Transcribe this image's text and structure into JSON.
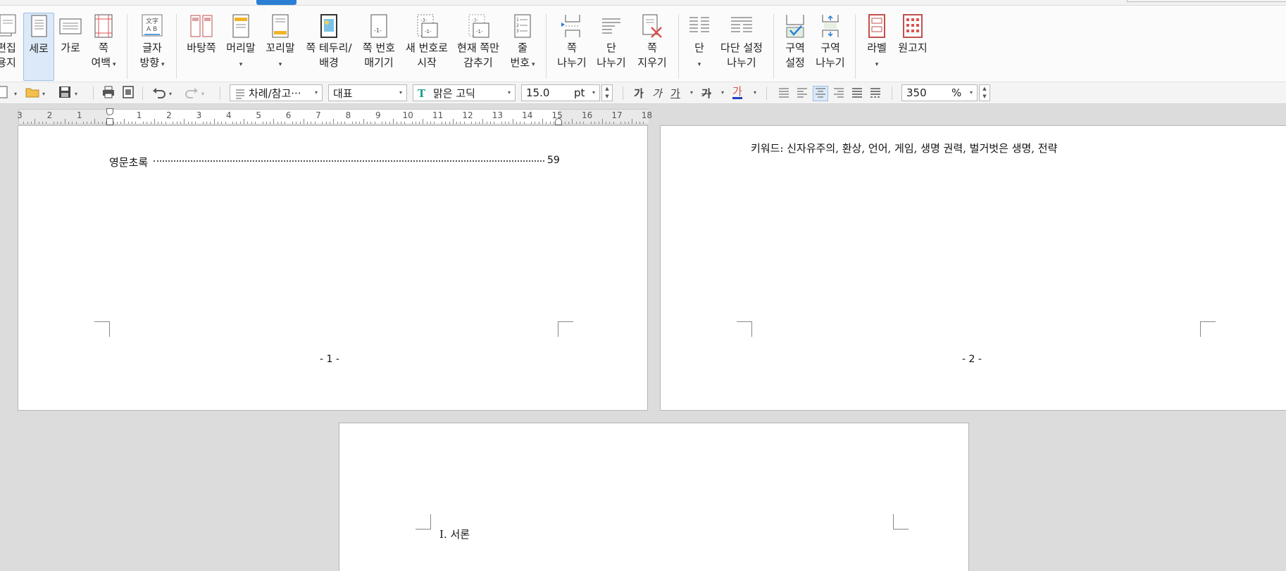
{
  "ribbon": {
    "items": [
      {
        "lines": [
          "편집",
          "용지"
        ],
        "dropdown": false
      },
      {
        "lines": [
          "세로"
        ],
        "dropdown": false,
        "active": true
      },
      {
        "lines": [
          "가로"
        ],
        "dropdown": false
      },
      {
        "lines": [
          "쪽",
          "여백"
        ],
        "dropdown": true
      },
      {
        "lines": [
          "글자",
          "방향"
        ],
        "dropdown": true
      },
      {
        "lines": [
          "바탕쪽"
        ],
        "dropdown": false
      },
      {
        "lines": [
          "머리말"
        ],
        "dropdown": true
      },
      {
        "lines": [
          "꼬리말"
        ],
        "dropdown": true
      },
      {
        "lines": [
          "쪽 테두리/",
          "배경"
        ],
        "dropdown": false
      },
      {
        "lines": [
          "쪽 번호",
          "매기기"
        ],
        "dropdown": false
      },
      {
        "lines": [
          "새 번호로",
          "시작"
        ],
        "dropdown": false
      },
      {
        "lines": [
          "현재 쪽만",
          "감추기"
        ],
        "dropdown": false
      },
      {
        "lines": [
          "줄",
          "번호"
        ],
        "dropdown": true
      },
      {
        "lines": [
          "쪽",
          "나누기"
        ],
        "dropdown": false
      },
      {
        "lines": [
          "단",
          "나누기"
        ],
        "dropdown": false
      },
      {
        "lines": [
          "쪽",
          "지우기"
        ],
        "dropdown": false
      },
      {
        "lines": [
          "단"
        ],
        "dropdown": true
      },
      {
        "lines": [
          "다단 설정",
          "나누기"
        ],
        "dropdown": false
      },
      {
        "lines": [
          "구역",
          "설정"
        ],
        "dropdown": false
      },
      {
        "lines": [
          "구역",
          "나누기"
        ],
        "dropdown": false
      },
      {
        "lines": [
          "라벨"
        ],
        "dropdown": true
      },
      {
        "lines": [
          "원고지"
        ],
        "dropdown": false
      }
    ]
  },
  "toolbar": {
    "style_combo": "차례/참고···",
    "style_name": "대표",
    "font_name": "맑은 고딕",
    "font_size": "15.0",
    "font_unit": "pt",
    "format_bold": "가",
    "format_italic": "가",
    "format_underline": "가",
    "format_strike": "가",
    "format_color": "가",
    "zoom_value": "350",
    "zoom_unit": "%"
  },
  "ruler": {
    "labels": [
      "3",
      "2",
      "1",
      "",
      "1",
      "2",
      "3",
      "4",
      "5",
      "6",
      "7",
      "8",
      "9",
      "10",
      "11",
      "12",
      "13",
      "14",
      "15",
      "16",
      "17",
      "18"
    ]
  },
  "document": {
    "page1": {
      "toc_title": "영문초록",
      "toc_page": "59",
      "footer": "- 1 -"
    },
    "page2": {
      "keywords": "키워드: 신자유주의, 환상, 언어, 게임, 생명 권력, 벌거벗은 생명, 전략",
      "footer": "- 2 -"
    },
    "page3": {
      "heading": "I. 서론"
    }
  },
  "colors": {
    "accent": "#2a7fd4",
    "active_bg": "#dce9f8",
    "workspace": "#dcdcdc"
  }
}
